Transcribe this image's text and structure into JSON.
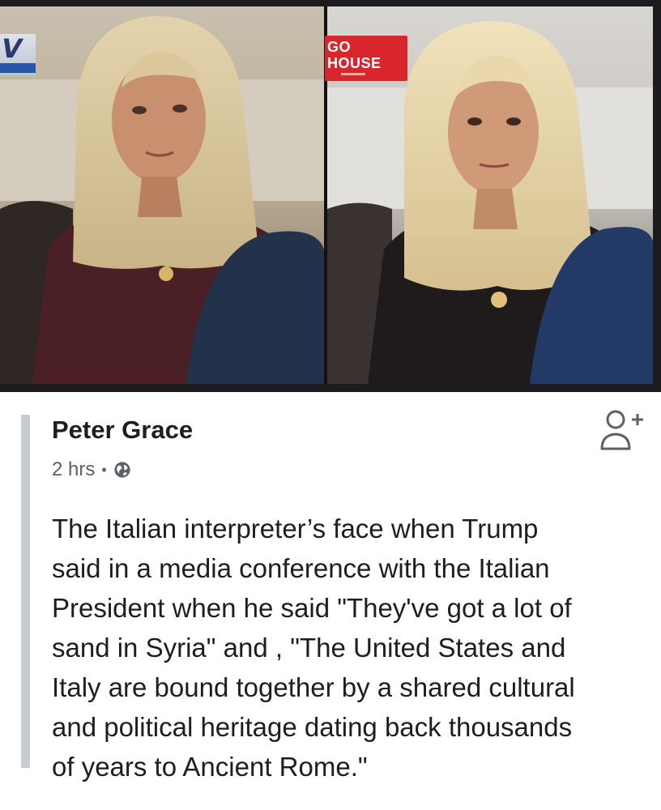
{
  "image": {
    "banner_logo_text": "V",
    "tv_banner_line1": "GO",
    "tv_banner_line2": "HOUSE"
  },
  "post": {
    "author": "Peter Grace",
    "time": "2 hrs",
    "separator": "•",
    "privacy_icon": "globe-icon",
    "add_friend_icon": "add-friend-icon",
    "text": "The Italian interpreter’s face when Trump\nsaid in a media conference with the Italian\nPresident when he said \"They've got a lot of\nsand in Syria\" and , \"The United States and\nItaly are bound together by a shared cultural\nand political heritage dating back thousands\nof years to Ancient Rome.\""
  },
  "colors": {
    "accent_bar": "#c8cbd0",
    "tv_banner_red": "#d9262c",
    "text": "#1c1e21",
    "meta": "#5b6168"
  }
}
